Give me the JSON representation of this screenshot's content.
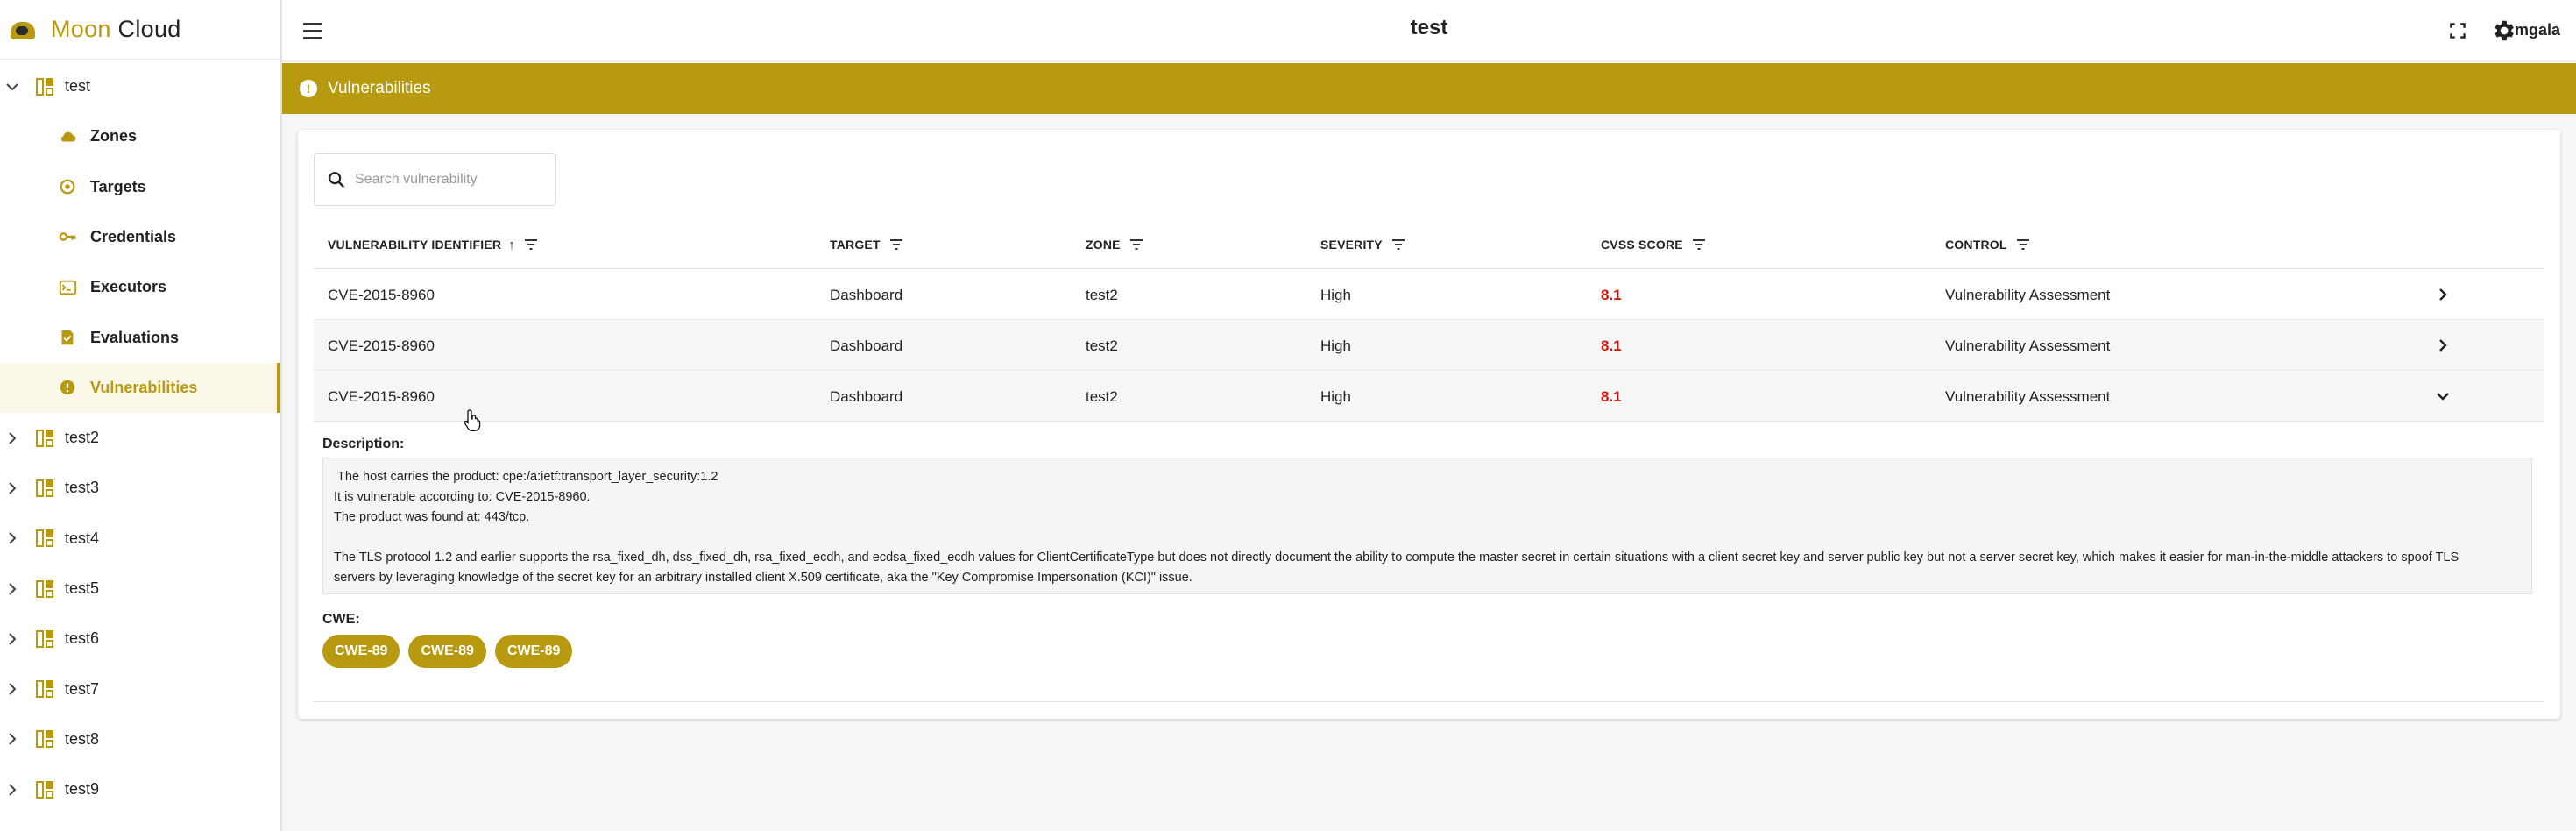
{
  "brand": {
    "name_part1": "Moon",
    "name_part2": " Cloud"
  },
  "header": {
    "title": "test",
    "username": "mgala"
  },
  "sidebar": {
    "projects": [
      {
        "label": "test",
        "expanded": true
      },
      {
        "label": "test2"
      },
      {
        "label": "test3"
      },
      {
        "label": "test4"
      },
      {
        "label": "test5"
      },
      {
        "label": "test6"
      },
      {
        "label": "test7"
      },
      {
        "label": "test8"
      },
      {
        "label": "test9"
      }
    ],
    "sub_items": [
      {
        "label": "Zones",
        "icon": "cloud-icon"
      },
      {
        "label": "Targets",
        "icon": "target-icon"
      },
      {
        "label": "Credentials",
        "icon": "key-icon"
      },
      {
        "label": "Executors",
        "icon": "terminal-icon"
      },
      {
        "label": "Evaluations",
        "icon": "checklist-icon"
      },
      {
        "label": "Vulnerabilities",
        "icon": "alert-icon",
        "active": true
      }
    ]
  },
  "section": {
    "title": "Vulnerabilities"
  },
  "search": {
    "placeholder": "Search vulnerability"
  },
  "table": {
    "columns": [
      "VULNERABILITY IDENTIFIER",
      "TARGET",
      "ZONE",
      "SEVERITY",
      "CVSS SCORE",
      "CONTROL"
    ],
    "sort_indicator": "↑",
    "rows": [
      {
        "id": "CVE-2015-8960",
        "target": "Dashboard",
        "zone": "test2",
        "severity": "High",
        "score": "8.1",
        "control": "Vulnerability Assessment",
        "expanded": false
      },
      {
        "id": "CVE-2015-8960",
        "target": "Dashboard",
        "zone": "test2",
        "severity": "High",
        "score": "8.1",
        "control": "Vulnerability Assessment",
        "expanded": false
      },
      {
        "id": "CVE-2015-8960",
        "target": "Dashboard",
        "zone": "test2",
        "severity": "High",
        "score": "8.1",
        "control": "Vulnerability Assessment",
        "expanded": true
      }
    ]
  },
  "detail": {
    "description_label": "Description:",
    "description_lines": [
      " The host carries the product: cpe:/a:ietf:transport_layer_security:1.2",
      "It is vulnerable according to: CVE-2015-8960.",
      "The product was found at: 443/tcp.",
      "",
      "The TLS protocol 1.2 and earlier supports the rsa_fixed_dh, dss_fixed_dh, rsa_fixed_ecdh, and ecdsa_fixed_ecdh values for ClientCertificateType but does not directly document the ability to compute the master secret in certain situations with a client secret key and server public key but not a server secret key, which makes it easier for man-in-the-middle attackers to spoof TLS",
      "servers by leveraging knowledge of the secret key for an arbitrary installed client X.509 certificate, aka the \"Key Compromise Impersonation (KCI)\" issue."
    ],
    "cwe_label": "CWE:",
    "cwe_chips": [
      "CWE-89",
      "CWE-89",
      "CWE-89"
    ]
  },
  "colors": {
    "accent": "#b89a10",
    "score": "#d0160f"
  }
}
